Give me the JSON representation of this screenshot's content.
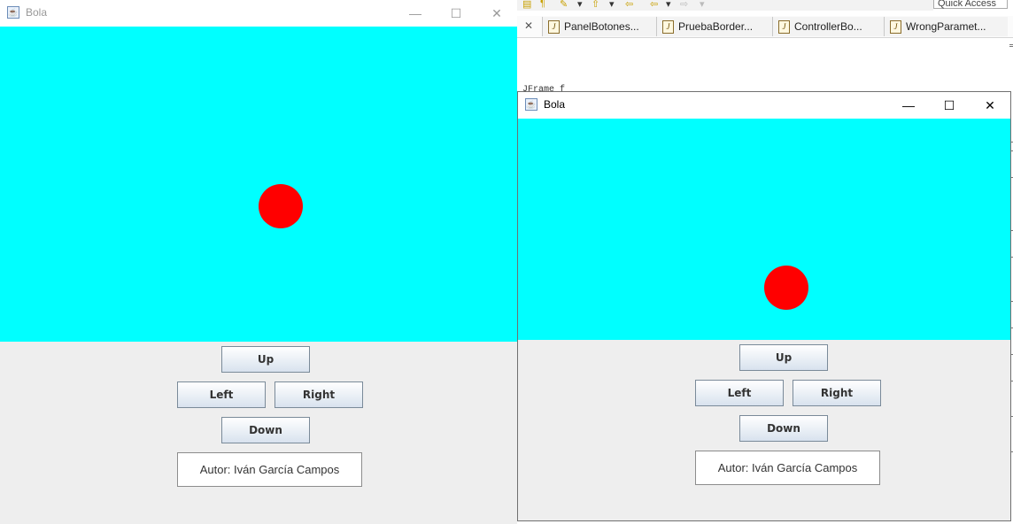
{
  "ide": {
    "quick_access": "Quick Access",
    "tabs": [
      {
        "label": "PanelBotones..."
      },
      {
        "label": "PruebaBorder..."
      },
      {
        "label": "ControllerBo..."
      },
      {
        "label": "WrongParamet..."
      }
    ],
    "code_fragment": "JFrame f"
  },
  "window_inactive": {
    "title": "Bola",
    "icon": "java-cup-icon",
    "controls": {
      "minimize": "—",
      "maximize": "☐",
      "close": "✕"
    },
    "canvas_color": "#00ffff",
    "ball_color": "#ff0000",
    "buttons": {
      "up": "Up",
      "left": "Left",
      "right": "Right",
      "down": "Down"
    },
    "author": "Autor: Iván García Campos"
  },
  "window_active": {
    "title": "Bola",
    "icon": "java-cup-icon",
    "controls": {
      "minimize": "—",
      "maximize": "☐",
      "close": "✕"
    },
    "canvas_color": "#00ffff",
    "ball_color": "#ff0000",
    "buttons": {
      "up": "Up",
      "left": "Left",
      "right": "Right",
      "down": "Down"
    },
    "author": "Autor: Iván García Campos"
  }
}
